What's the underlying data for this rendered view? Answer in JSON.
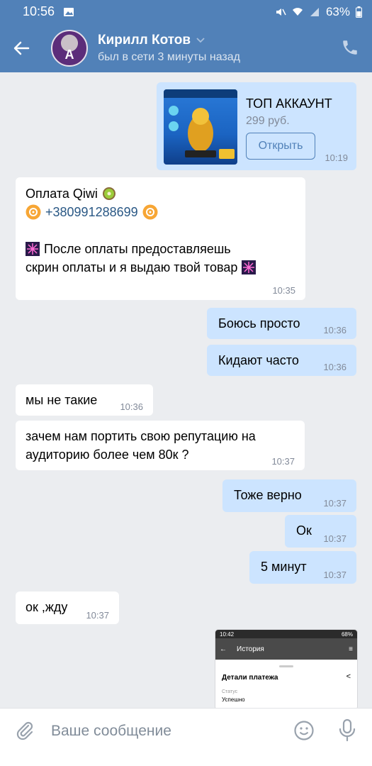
{
  "status_bar": {
    "time": "10:56",
    "battery": "63%"
  },
  "header": {
    "name": "Кирилл Котов",
    "last_seen": "был в сети 3 минуты назад"
  },
  "messages": {
    "card": {
      "title": "ТОП АККАУНТ",
      "price": "299 руб.",
      "open_label": "Открыть",
      "time": "10:19"
    },
    "payment": {
      "line1": "Оплата Qiwi",
      "phone": "+380991288699",
      "line3": "После оплаты предоставляешь",
      "line4": "скрин оплаты и я выдаю твой товар",
      "time": "10:35"
    },
    "m1": {
      "text": "Боюсь просто",
      "time": "10:36"
    },
    "m2": {
      "text": "Кидают часто",
      "time": "10:36"
    },
    "m3": {
      "text": "мы не такие",
      "time": "10:36"
    },
    "m4": {
      "text1": "зачем нам портить свою репутацию на",
      "text2": "аудиторию более чем 80к ?",
      "time": "10:37"
    },
    "m5": {
      "text": "Тоже верно",
      "time": "10:37"
    },
    "m6": {
      "text": "Ок",
      "time": "10:37"
    },
    "m7": {
      "text": "5 минут",
      "time": "10:37"
    },
    "m8": {
      "text": "ок ,жду",
      "time": "10:37"
    },
    "screenshot": {
      "time": "10:42",
      "battery": "68%",
      "title": "История",
      "heading": "Детали платежа",
      "status_label": "Статус",
      "status_value": "Успешно"
    }
  },
  "input": {
    "placeholder": "Ваше сообщение"
  }
}
